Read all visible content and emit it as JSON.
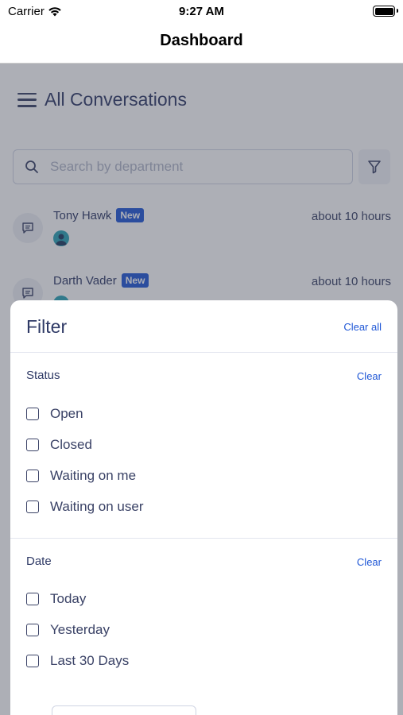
{
  "status_bar": {
    "carrier": "Carrier",
    "time": "9:27 AM"
  },
  "nav": {
    "title": "Dashboard"
  },
  "main": {
    "title": "All Conversations",
    "search": {
      "placeholder": "Search by department",
      "value": ""
    },
    "conversations": [
      {
        "name": "Tony Hawk",
        "badge": "New",
        "time": "about 10 hours"
      },
      {
        "name": "Darth Vader",
        "badge": "New",
        "time": "about 10 hours"
      }
    ]
  },
  "filter": {
    "title": "Filter",
    "clear_all": "Clear all",
    "sections": [
      {
        "title": "Status",
        "clear": "Clear",
        "options": [
          "Open",
          "Closed",
          "Waiting on me",
          "Waiting on user"
        ]
      },
      {
        "title": "Date",
        "clear": "Clear",
        "options": [
          "Today",
          "Yesterday",
          "Last 30 Days"
        ]
      }
    ]
  },
  "colors": {
    "accent": "#1f57d6",
    "text": "#3a4266",
    "overlay": "#3c4050"
  }
}
